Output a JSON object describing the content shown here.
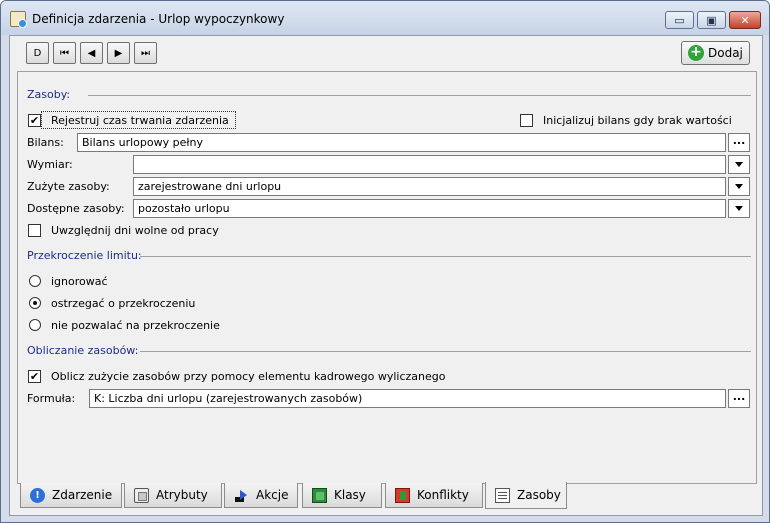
{
  "window": {
    "title": "Definicja zdarzenia - Urlop wypoczynkowy",
    "controls": {
      "minimize": "▭",
      "maximize": "▣",
      "close": "✕"
    }
  },
  "toolbar": {
    "nav": [
      "D",
      "⏮",
      "◀",
      "▶",
      "⏭"
    ],
    "add_label": "Dodaj",
    "add_icon": "+"
  },
  "zasoby": {
    "section_title": "Zasoby:",
    "register_label": "Rejestruj czas trwania zdarzenia",
    "register_checked": "✔",
    "init_label": "Inicjalizuj bilans gdy brak wartości",
    "init_checked": "",
    "bilans_label": "Bilans:",
    "bilans_value": "Bilans urlopowy pełny",
    "ellipsis": "...",
    "wymiar_label": "Wymiar:",
    "wymiar_value": "",
    "zuzyte_label": "Zużyte zasoby:",
    "zuzyte_value": "zarejestrowane dni urlopu",
    "dostepne_label": "Dostępne zasoby:",
    "dostepne_value": "pozostało urlopu",
    "wolne_label": "Uwzględnij dni wolne od pracy",
    "wolne_checked": ""
  },
  "limit": {
    "section_title": "Przekroczenie limitu:",
    "options": [
      "ignorować",
      "ostrzegać o przekroczeniu",
      "nie pozwalać na przekroczenie"
    ],
    "selected": "ostrzegać o przekroczeniu"
  },
  "obliczanie": {
    "section_title": "Obliczanie zasobów:",
    "calc_label": "Oblicz zużycie zasobów przy pomocy elementu kadrowego wyliczanego",
    "calc_checked": "✔",
    "formula_label": "Formuła:",
    "formula_value": "K: Liczba dni urlopu (zarejestrowanych zasobów)",
    "ellipsis": "..."
  },
  "tabs": [
    {
      "label": "Zdarzenie",
      "icon": "info-icon"
    },
    {
      "label": "Atrybuty",
      "icon": "attributes-icon"
    },
    {
      "label": "Akcje",
      "icon": "actions-icon"
    },
    {
      "label": "Klasy",
      "icon": "classes-icon"
    },
    {
      "label": "Konflikty",
      "icon": "conflicts-icon"
    },
    {
      "label": "Zasoby",
      "icon": "resources-icon",
      "active": true
    }
  ],
  "tab_info_glyph": "!"
}
